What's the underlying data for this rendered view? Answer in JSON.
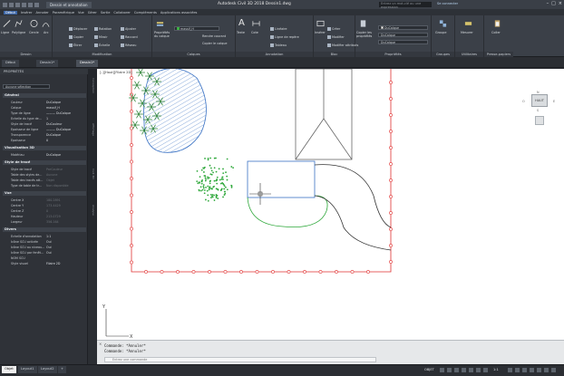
{
  "titlebar": {
    "doc_tab": "Dessin et annotation",
    "title": "Autodesk Civil 3D 2018   Dessin1.dwg",
    "search_placeholder": "Entrez un mot-clé ou une expression",
    "user": "Se connecter",
    "window_controls": [
      "–",
      "□",
      "×"
    ]
  },
  "menubar": {
    "items": [
      "Début",
      "Fichier",
      "Edition",
      "Affichage",
      "Insertion",
      "Format",
      "Outils",
      "Dessin",
      "Cotation",
      "Modification",
      "Paramétrique",
      "Fenêtre",
      "Aide"
    ],
    "ribbon_tabs": [
      "Début",
      "Insérer",
      "Annoter",
      "Paramétrique",
      "Vue",
      "Gérer",
      "Sortie",
      "Collaborer",
      "Compléments",
      "Applications associées"
    ]
  },
  "ribbon": {
    "draw": {
      "label": "Dessin",
      "line": "Ligne",
      "polyline": "Polyligne",
      "circle": "Cercle",
      "arc": "Arc"
    },
    "modify": {
      "label": "Modification",
      "move": "Déplacer",
      "copy": "Copier",
      "stretch": "Étirer",
      "rotate": "Rotation",
      "mirror": "Miroir",
      "scale": "Échelle",
      "trim": "Ajuster",
      "fillet": "Raccord",
      "array": "Réseau"
    },
    "layers": {
      "label": "Calques",
      "props": "Propriétés du calque",
      "current": "massif_H",
      "make_current": "Rendre courant",
      "match": "Copier le calque"
    },
    "annotation": {
      "label": "Annotation",
      "text": "Texte",
      "dim": "Cote",
      "linear": "Linéaire",
      "leader": "Ligne de repère",
      "table": "Tableau"
    },
    "block": {
      "label": "Bloc",
      "insert": "Insérer",
      "create": "Créer",
      "edit": "Modifier",
      "attrs": "Modifier attributs"
    },
    "properties": {
      "label": "Propriétés",
      "match": "Copier les propriétés",
      "color": "DuCalque",
      "lineweight": "DuCalque",
      "linetype": "DuCalque"
    },
    "groups": {
      "label": "Groupes",
      "group": "Groupe"
    },
    "utilities": {
      "label": "Utilitaires",
      "measure": "Mesurer"
    },
    "clipboard": {
      "label": "Presse-papiers",
      "paste": "Coller"
    }
  },
  "doc_tabs": [
    "Début",
    "Dessin1*",
    "Dessin1*"
  ],
  "properties": {
    "header": "PROPRIÉTÉS",
    "selection": "Aucune sélection",
    "sections": {
      "general": {
        "title": "Général",
        "rows": [
          [
            "Couleur",
            "DuCalque"
          ],
          [
            "Calque",
            "massif_H"
          ],
          [
            "Type de ligne",
            "——— DuCalque"
          ],
          [
            "Echelle du type de...",
            "1"
          ],
          [
            "Style de tracé",
            "DuCouleur"
          ],
          [
            "Epaisseur de ligne",
            "——— DuCalque"
          ],
          [
            "Transparence",
            "DuCalque"
          ],
          [
            "Epaisseur",
            "0"
          ]
        ]
      },
      "visual3d": {
        "title": "Visualisation 3D",
        "rows": [
          [
            "Matériau",
            "DuCalque"
          ]
        ]
      },
      "plot": {
        "title": "Style de tracé",
        "rows": [
          [
            "Style de tracé",
            "ParCouleur"
          ],
          [
            "Table des styles de...",
            "Aucune"
          ],
          [
            "Table des tracés att...",
            "Objet"
          ],
          [
            "Type de table de tr...",
            "Non disponible"
          ]
        ]
      },
      "view": {
        "title": "Vue",
        "rows": [
          [
            "Centre X",
            "180.2891"
          ],
          [
            "Centre Y",
            "173.4429"
          ],
          [
            "Centre Z",
            "0"
          ],
          [
            "Hauteur",
            "213.0729"
          ],
          [
            "Largeur",
            "356.164"
          ]
        ]
      },
      "misc": {
        "title": "Divers",
        "rows": [
          [
            "Echelle d'annotation",
            "1:1"
          ],
          [
            "Icône SCU activée",
            "Oui"
          ],
          [
            "Icône SCU au niveau...",
            "Oui"
          ],
          [
            "Icône SCU par fenêt...",
            "Oui"
          ],
          [
            "NOM SCU",
            ""
          ],
          [
            "Style visuel",
            "Filaire 2D"
          ]
        ]
      }
    },
    "side_tabs": [
      "Conception",
      "Affichage",
      "Civil 3D",
      "Analyse"
    ]
  },
  "canvas": {
    "view_label": "[–][Haut][Filaire 2D]",
    "viewcube": {
      "top": "HAUT",
      "n": "N",
      "s": "S",
      "e": "E",
      "w": "O"
    }
  },
  "command": {
    "lines": [
      "Commande: *Annuler*",
      "Commande: *Annuler*"
    ],
    "placeholder": "Entrez une commande"
  },
  "status": {
    "layout_tabs": [
      "Objet",
      "Layout1",
      "Layout2",
      "+"
    ],
    "scale": "1:1",
    "mode": "OBJET"
  }
}
